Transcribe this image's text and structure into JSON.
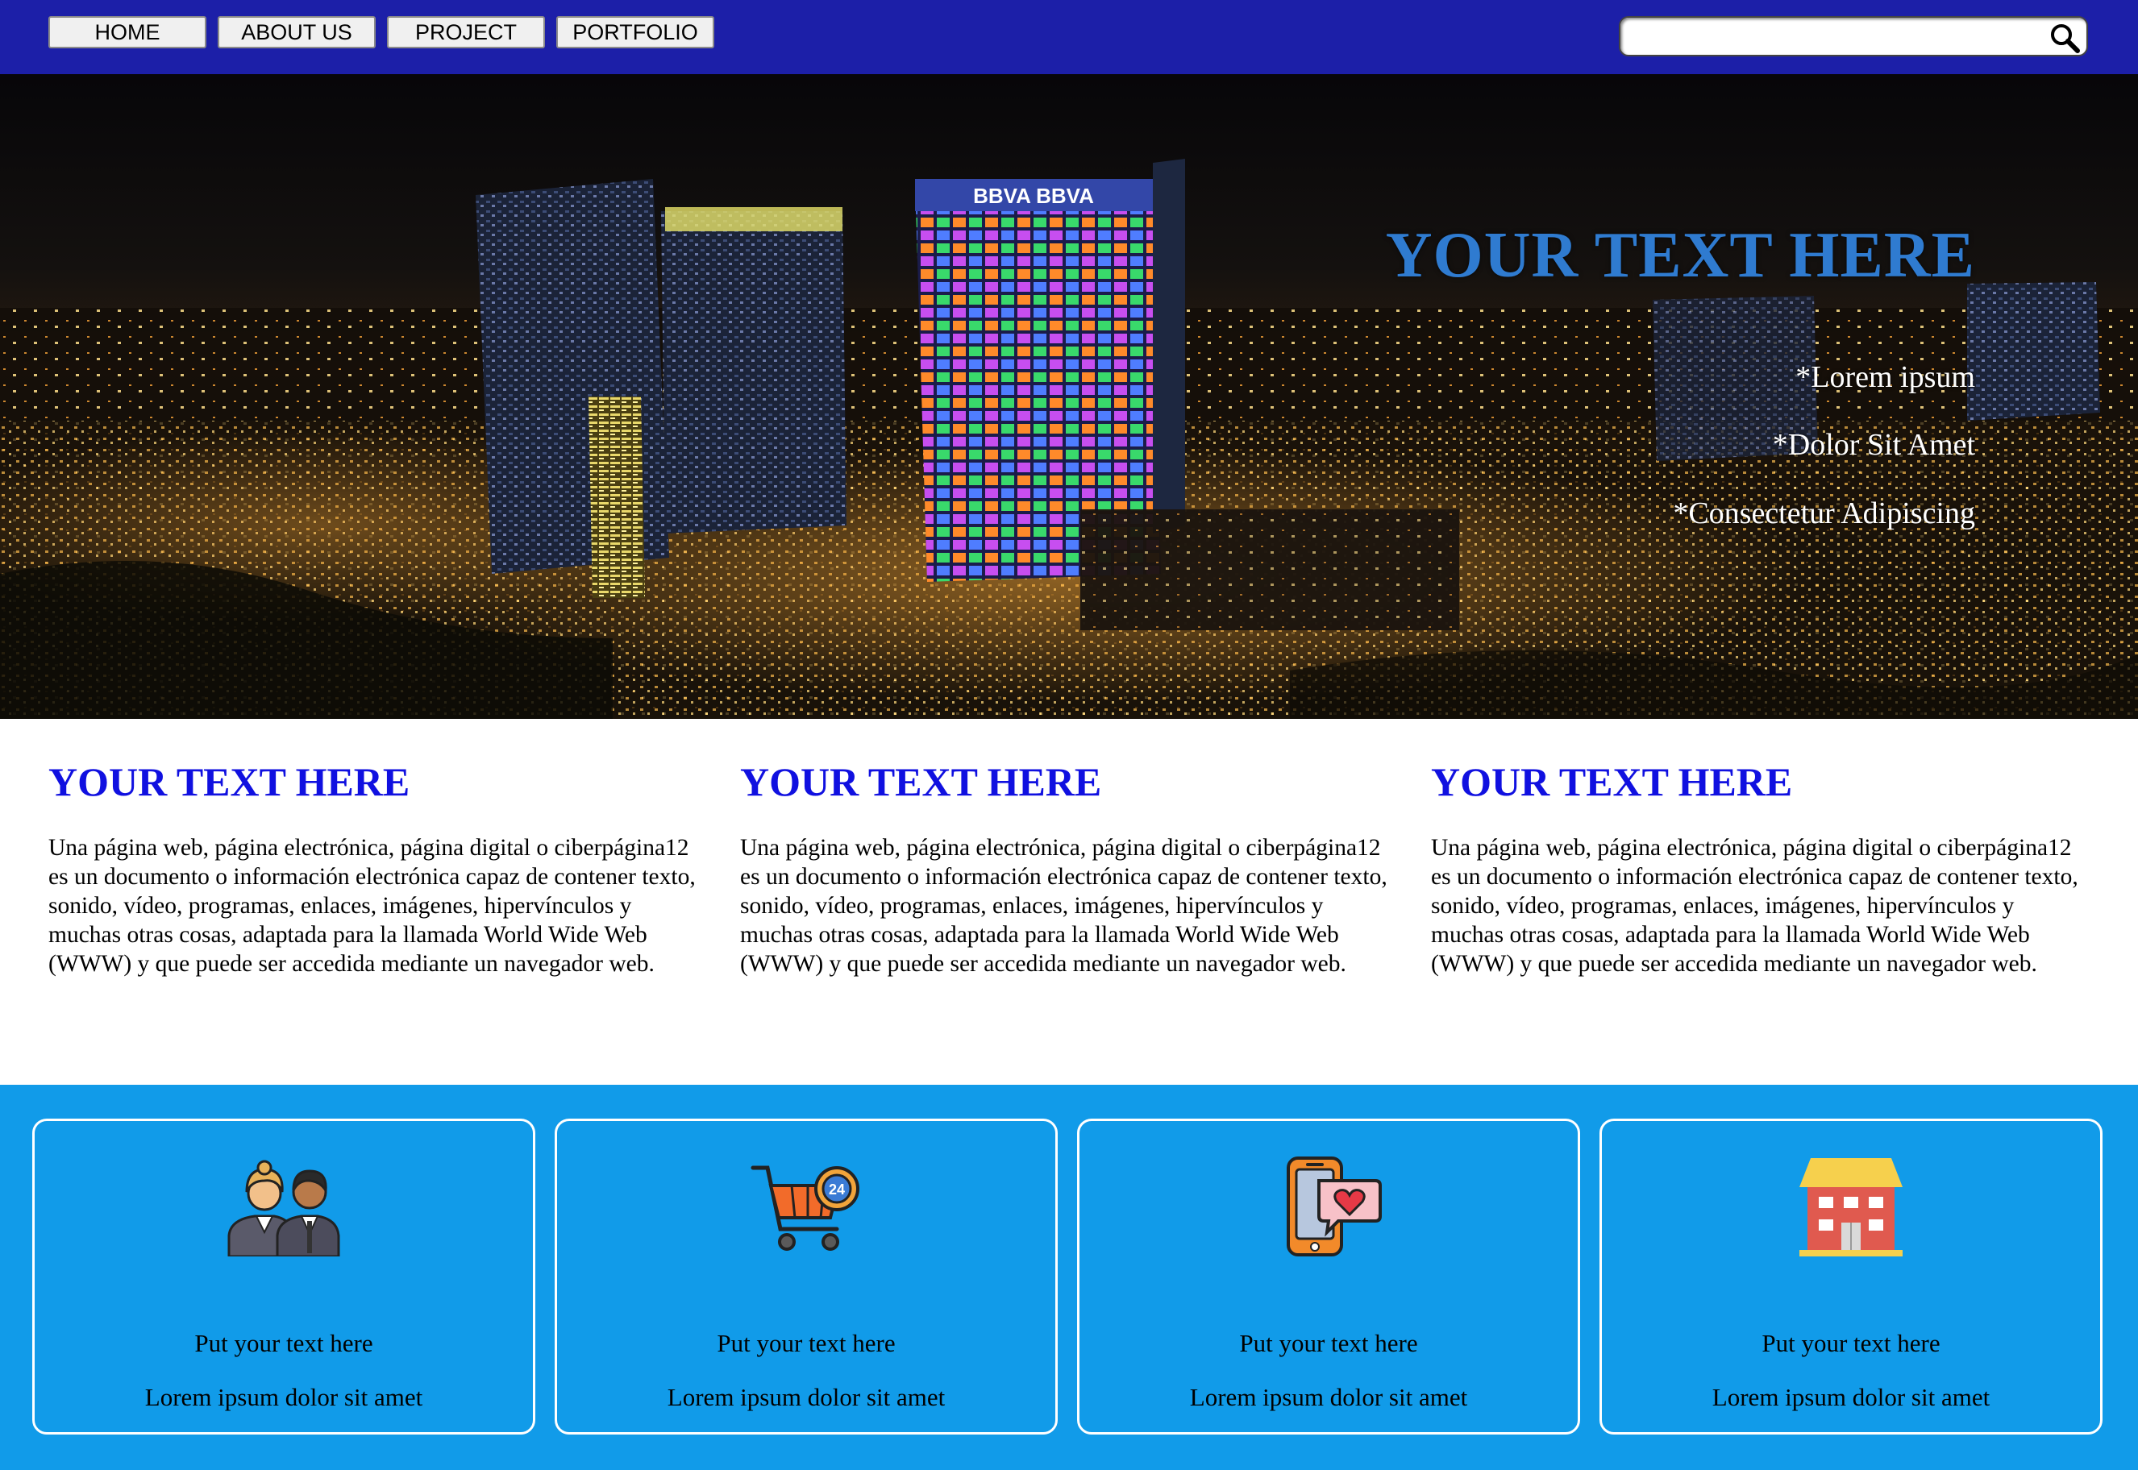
{
  "nav": {
    "items": [
      {
        "label": "HOME"
      },
      {
        "label": "ABOUT US"
      },
      {
        "label": "PROJECT"
      },
      {
        "label": "PORTFOLIO"
      }
    ],
    "search": {
      "value": "",
      "placeholder": ""
    }
  },
  "hero": {
    "title": "YOUR TEXT HERE",
    "items": [
      "*Lorem ipsum",
      "*Dolor Sit Amet",
      "*Consectetur Adipiscing"
    ],
    "building_sign": "BBVA BBVA"
  },
  "columns": [
    {
      "title": "YOUR TEXT HERE",
      "body": "Una página web, página electrónica, página digital o ciberpágina12 es un documento o información electrónica capaz de contener texto, sonido, vídeo, programas, enlaces, imágenes, hipervínculos y muchas otras cosas, adaptada para la llamada World Wide Web (WWW) y que puede ser accedida mediante un navegador web."
    },
    {
      "title": "YOUR TEXT HERE",
      "body": "Una página web, página electrónica, página digital o ciberpágina12 es un documento o información electrónica capaz de contener texto, sonido, vídeo, programas, enlaces, imágenes, hipervínculos y muchas otras cosas, adaptada para la llamada World Wide Web (WWW) y que puede ser accedida mediante un navegador web."
    },
    {
      "title": "YOUR TEXT HERE",
      "body": "Una página web, página electrónica, página digital o ciberpágina12 es un documento o información electrónica capaz de contener texto, sonido, vídeo, programas, enlaces, imágenes, hipervínculos y muchas otras cosas, adaptada para la llamada World Wide Web (WWW) y que puede ser accedida mediante un navegador web."
    }
  ],
  "cards": [
    {
      "icon": "people-icon",
      "line1": "Put your text here",
      "line2": "Lorem ipsum dolor sit amet"
    },
    {
      "icon": "shopping-cart-24h-icon",
      "line1": "Put your text here",
      "line2": "Lorem ipsum dolor sit amet"
    },
    {
      "icon": "phone-heart-icon",
      "line1": "Put your text here",
      "line2": "Lorem ipsum dolor sit amet"
    },
    {
      "icon": "store-icon",
      "line1": "Put your text here",
      "line2": "Lorem ipsum dolor sit amet"
    }
  ],
  "colors": {
    "nav_bg": "#1c1fa8",
    "hero_title": "#2f7bd0",
    "column_title": "#1010e0",
    "band_bg": "#119be9"
  }
}
